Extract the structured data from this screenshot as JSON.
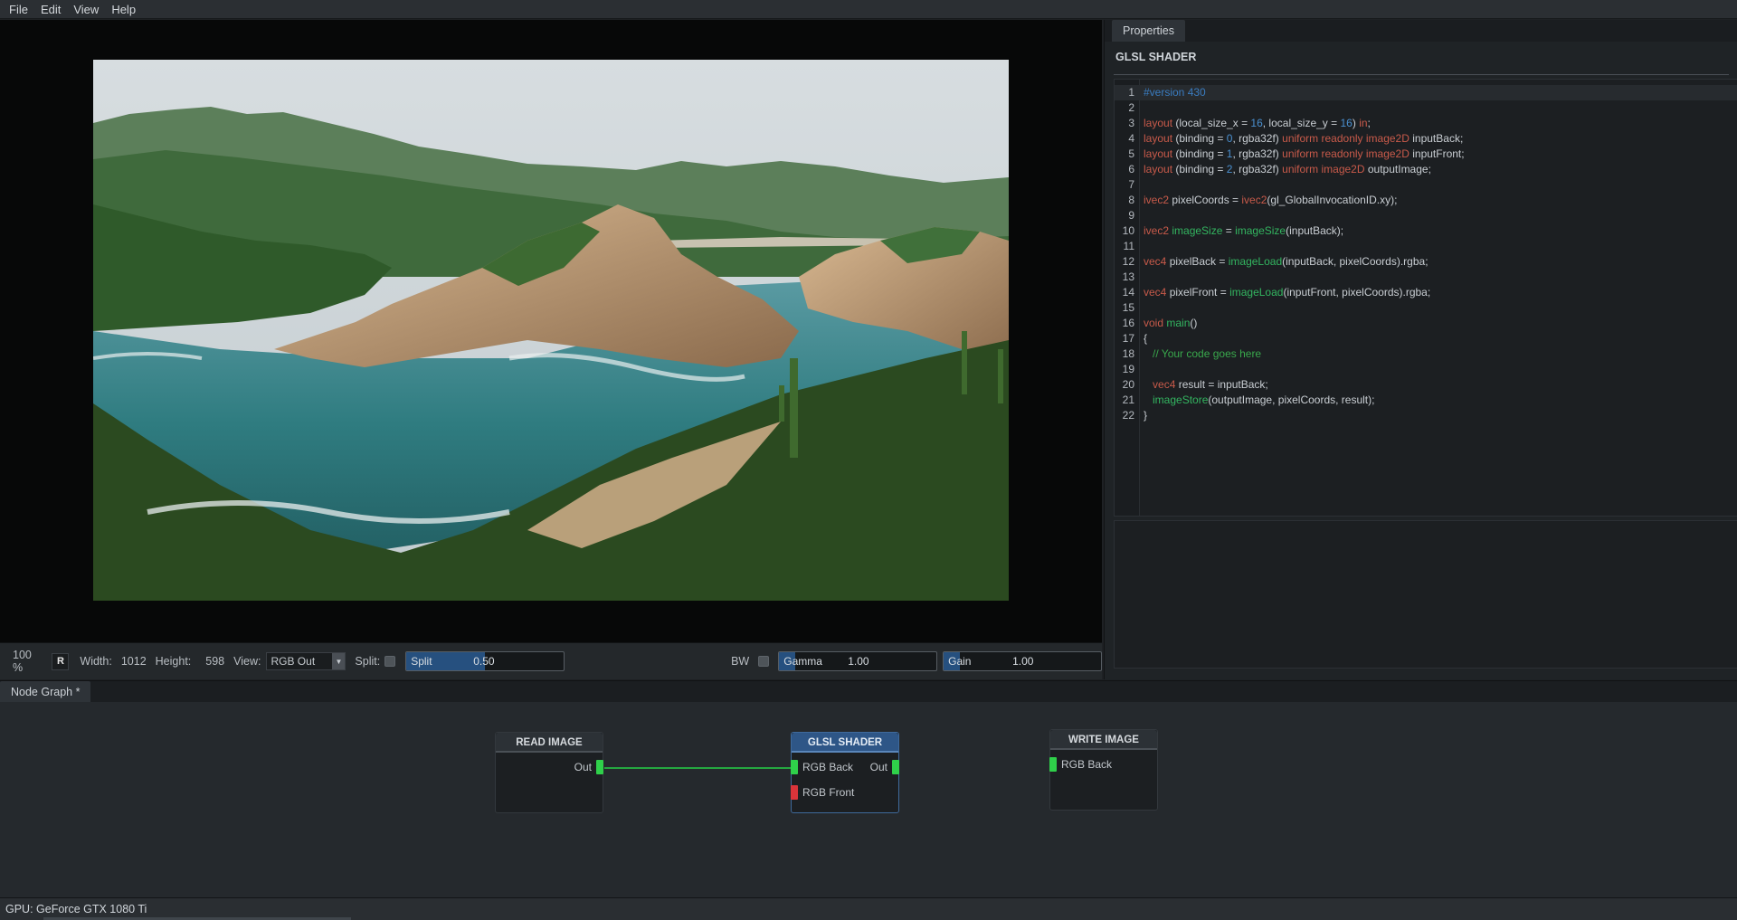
{
  "menu": {
    "items": [
      "File",
      "Edit",
      "View",
      "Help"
    ]
  },
  "viewer": {
    "zoom": "100 %",
    "r_button": "R",
    "width_label": "Width:",
    "width_value": "1012",
    "height_label": "Height:",
    "height_value": "598",
    "view_label": "View:",
    "view_selected": "RGB Out",
    "split_label": "Split:",
    "split_slider": {
      "label": "Split",
      "value": "0.50",
      "fraction": 0.5
    },
    "bw_label": "BW",
    "gamma_slider": {
      "label": "Gamma",
      "value": "1.00",
      "fraction": 0.1
    },
    "gain_slider": {
      "label": "Gain",
      "value": "1.00",
      "fraction": 0.1
    },
    "image_description_icon": "landscape-photo"
  },
  "properties": {
    "tab": "Properties",
    "title": "GLSL SHADER",
    "code": [
      "#version 430",
      "",
      "layout (local_size_x = 16, local_size_y = 16) in;",
      "layout (binding = 0, rgba32f) uniform readonly image2D inputBack;",
      "layout (binding = 1, rgba32f) uniform readonly image2D inputFront;",
      "layout (binding = 2, rgba32f) uniform image2D outputImage;",
      "",
      "ivec2 pixelCoords = ivec2(gl_GlobalInvocationID.xy);",
      "",
      "ivec2 imageSize = imageSize(inputBack);",
      "",
      "vec4 pixelBack = imageLoad(inputBack, pixelCoords).rgba;",
      "",
      "vec4 pixelFront = imageLoad(inputFront, pixelCoords).rgba;",
      "",
      "void main()",
      "{",
      "   // Your code goes here",
      "",
      "   vec4 result = inputBack;",
      "   imageStore(outputImage, pixelCoords, result);",
      "}"
    ]
  },
  "node_graph": {
    "tab": "Node Graph *",
    "nodes": [
      {
        "title": "READ IMAGE",
        "outputs": [
          "Out"
        ],
        "inputs": []
      },
      {
        "title": "GLSL SHADER",
        "inputs": [
          "RGB Back",
          "RGB Front"
        ],
        "outputs": [
          "Out"
        ]
      },
      {
        "title": "WRITE IMAGE",
        "inputs": [
          "RGB Back"
        ],
        "outputs": []
      }
    ]
  },
  "status": {
    "gpu": "GPU: GeForce GTX 1080 Ti"
  },
  "colors": {
    "accent_blue": "#2e5687",
    "port_connected": "#2fd04a",
    "port_unconnected": "#d9343a",
    "keyword_red": "#c85a4a",
    "type_green": "#33b560",
    "number_blue": "#4a90d0"
  }
}
